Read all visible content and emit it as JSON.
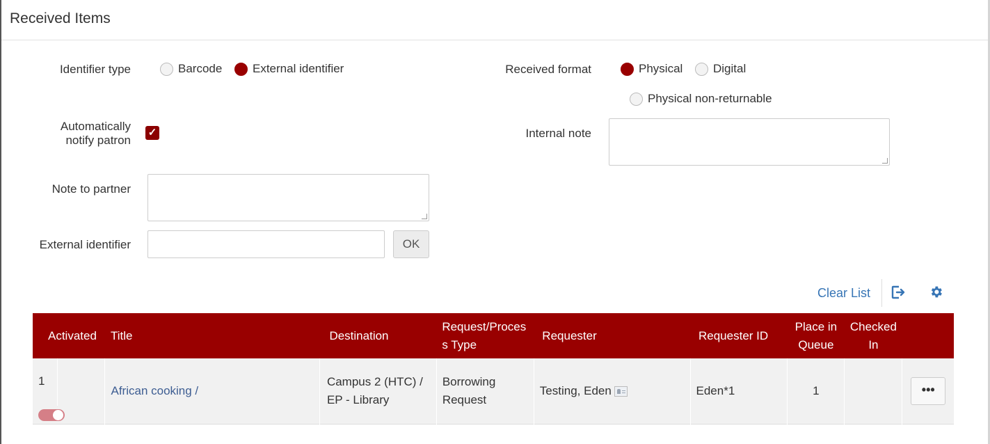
{
  "page": {
    "title": "Received Items"
  },
  "form": {
    "identifier_type_label": "Identifier type",
    "identifier_options": [
      {
        "label": "Barcode",
        "selected": false
      },
      {
        "label": "External identifier",
        "selected": true
      }
    ],
    "received_format_label": "Received format",
    "format_options": [
      {
        "label": "Physical",
        "selected": true
      },
      {
        "label": "Digital",
        "selected": false
      },
      {
        "label": "Physical non-returnable",
        "selected": false
      }
    ],
    "auto_notify_label_line1": "Automatically",
    "auto_notify_label_line2": "notify patron",
    "auto_notify_checked": true,
    "internal_note_label": "Internal note",
    "internal_note_value": "",
    "note_to_partner_label": "Note to partner",
    "note_to_partner_value": "",
    "external_identifier_label": "External identifier",
    "external_identifier_value": "",
    "ok_label": "OK"
  },
  "toolbar": {
    "clear_list_label": "Clear List",
    "export_icon": "export-icon",
    "settings_icon": "gear-icon"
  },
  "table": {
    "headers": {
      "activated": "Activated",
      "title": "Title",
      "destination": "Destination",
      "request_type_line1": "Request/Proces",
      "request_type_line2": "s Type",
      "requester": "Requester",
      "requester_id": "Requester ID",
      "place_line1": "Place in",
      "place_line2": "Queue",
      "checked_line1": "Checked",
      "checked_line2": "In"
    },
    "rows": [
      {
        "index": "1",
        "activated": true,
        "title": "African cooking /",
        "destination_line1": "Campus 2 (HTC) /",
        "destination_line2": "EP - Library",
        "request_type_line1": "Borrowing",
        "request_type_line2": "Request",
        "requester": "Testing, Eden",
        "requester_id": "Eden*1",
        "place_in_queue": "1",
        "checked_in": "",
        "actions_label": "•••"
      }
    ]
  },
  "colors": {
    "accent": "#990000",
    "link": "#3775b5"
  }
}
